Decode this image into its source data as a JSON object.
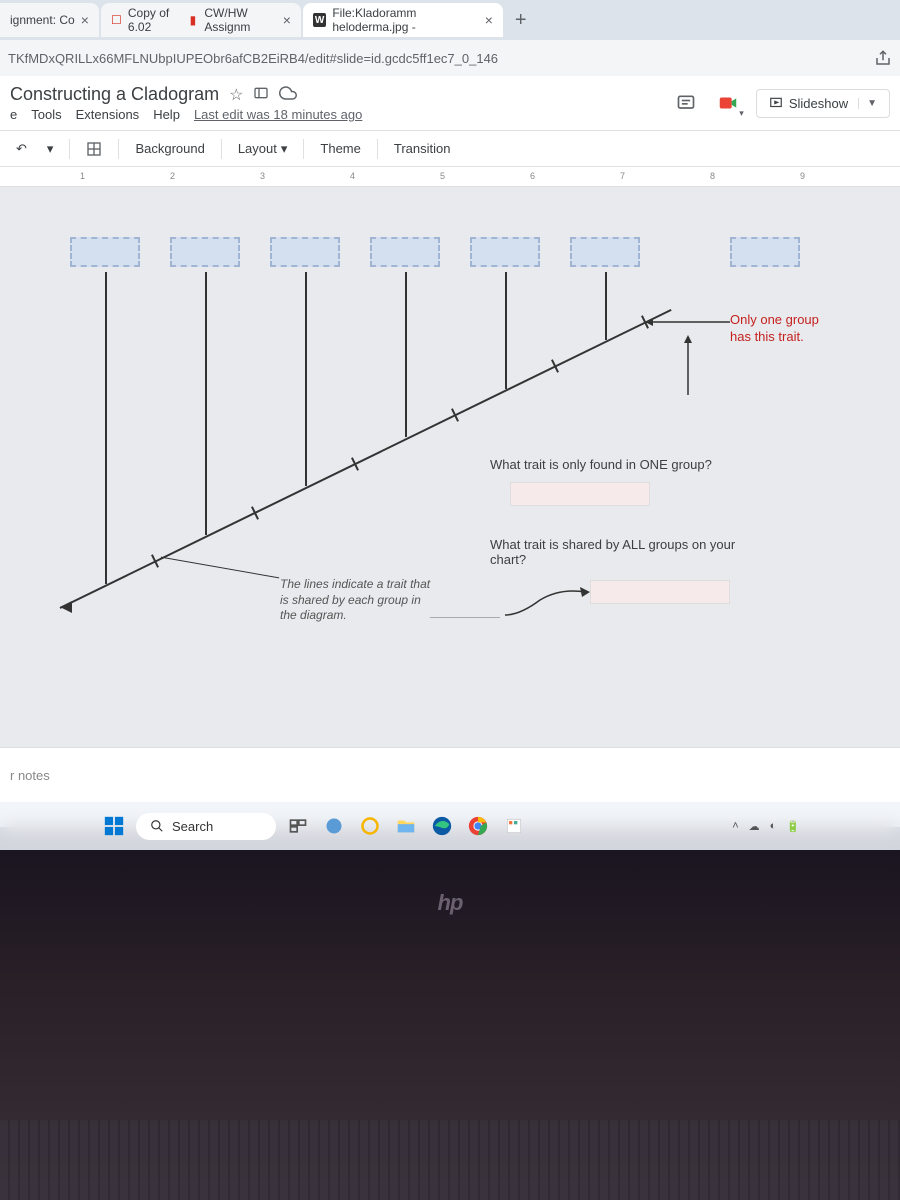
{
  "browser": {
    "tabs": [
      {
        "label": "ignment: Co",
        "icon": ""
      },
      {
        "label": "Copy of 6.02",
        "icon": "red",
        "suffix": "CW/HW Assignm"
      },
      {
        "label": "File:Kladoramm heloderma.jpg -",
        "icon": "W"
      }
    ],
    "new_tab": "+",
    "url": "TKfMDxQRILLx66MFLNUbpIUPEObr6afCB2EiRB4/edit#slide=id.gcdc5ff1ec7_0_146"
  },
  "header": {
    "title": "Constructing a Cladogram",
    "menus": [
      "e",
      "Tools",
      "Extensions",
      "Help"
    ],
    "last_edit": "Last edit was 18 minutes ago",
    "slideshow": "Slideshow"
  },
  "toolbar": {
    "background": "Background",
    "layout": "Layout",
    "theme": "Theme",
    "transition": "Transition"
  },
  "ruler": [
    "1",
    "2",
    "3",
    "4",
    "5",
    "6",
    "7",
    "8",
    "9"
  ],
  "slide": {
    "only_one_group": "Only one group\nhas this trait.",
    "lines_indicate": "The lines indicate a trait that\nis shared by each group in\nthe diagram.",
    "q1": "What trait is only found in ONE group?",
    "q2": "What trait is shared by ALL groups on your\nchart?"
  },
  "notes": {
    "placeholder": "r notes"
  },
  "taskbar": {
    "search": "Search"
  },
  "hp": "hp"
}
